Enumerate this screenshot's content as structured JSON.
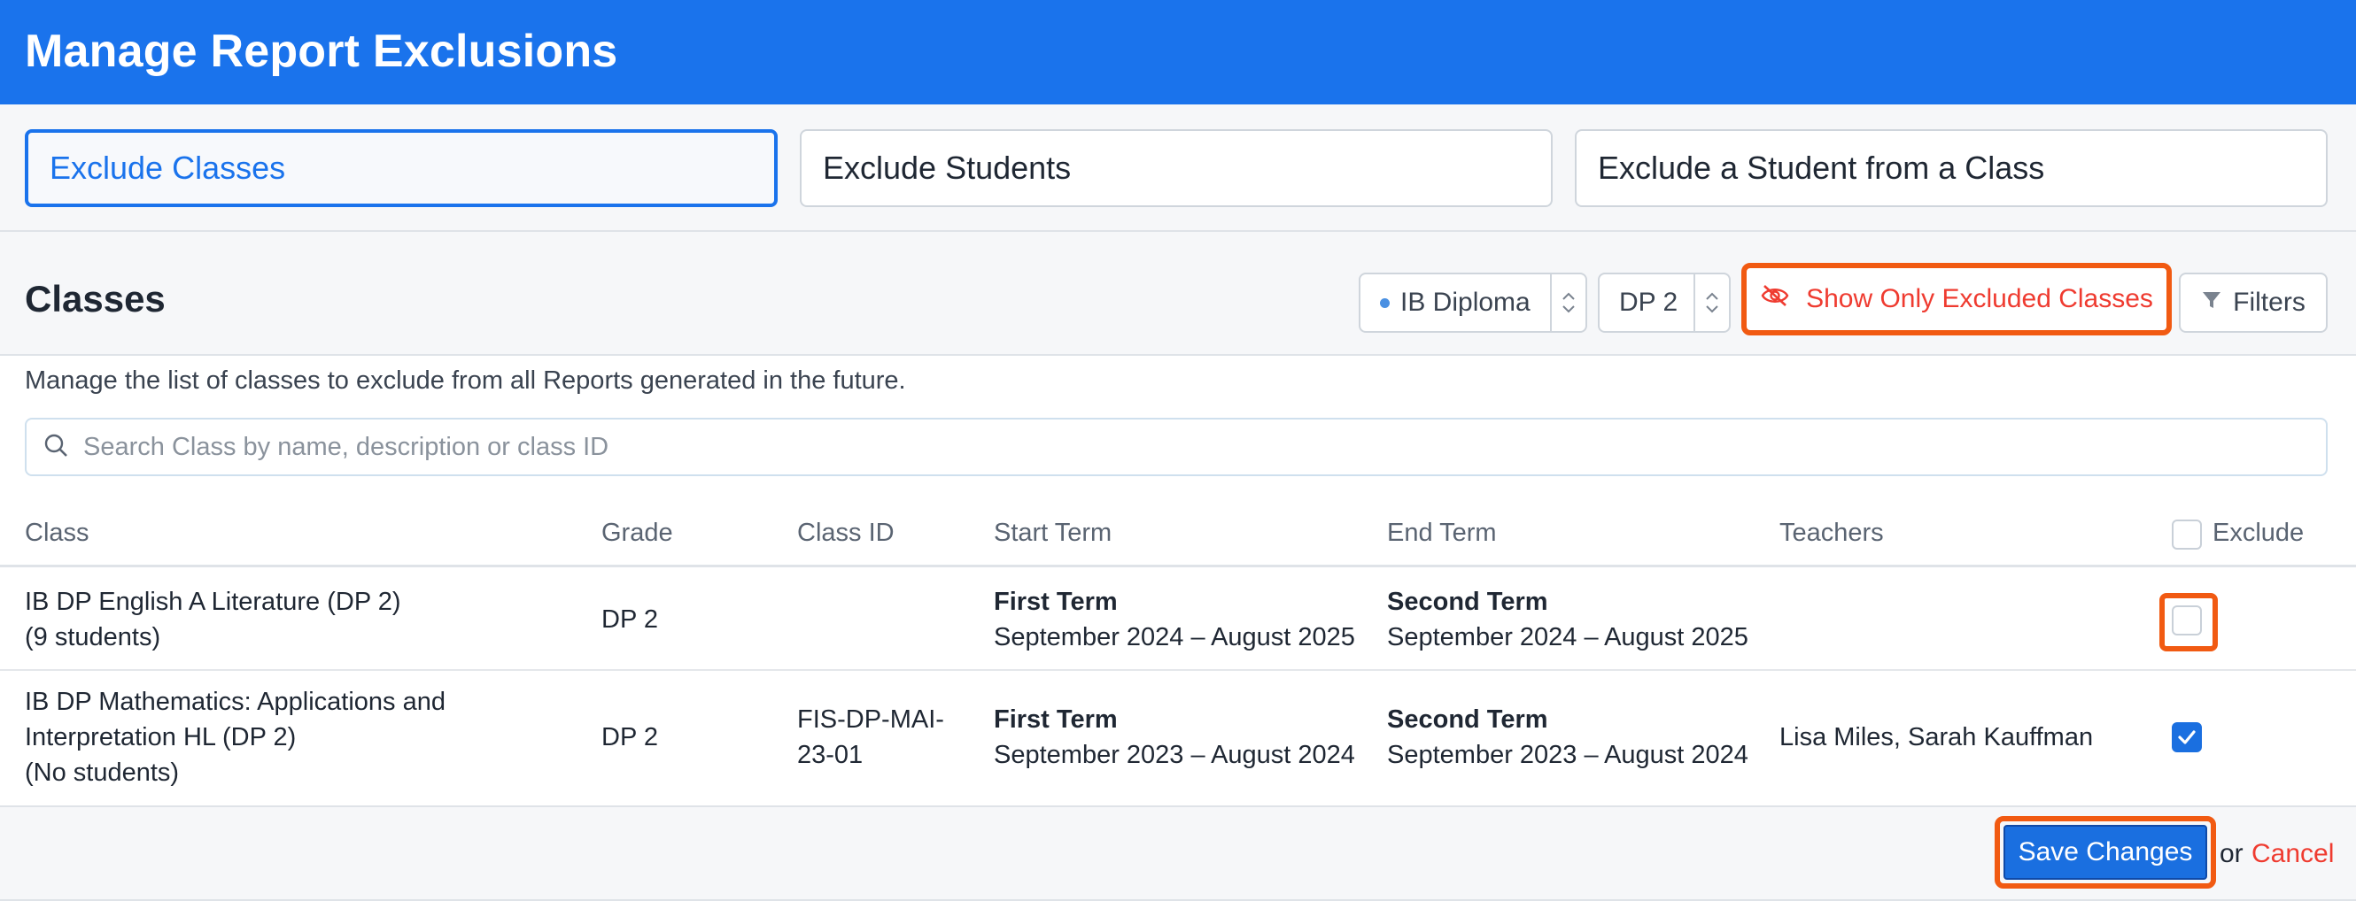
{
  "header": {
    "title": "Manage Report Exclusions"
  },
  "tabs": [
    {
      "label": "Exclude Classes",
      "active": true
    },
    {
      "label": "Exclude Students",
      "active": false
    },
    {
      "label": "Exclude a Student from a Class",
      "active": false
    }
  ],
  "toolbar": {
    "title": "Classes",
    "program_select": "IB Diploma",
    "grade_select": "DP 2",
    "show_excluded_label": "Show Only Excluded Classes",
    "filters_label": "Filters"
  },
  "description": "Manage the list of classes to exclude from all Reports generated in the future.",
  "search": {
    "placeholder": "Search Class by name, description or class ID",
    "value": ""
  },
  "table": {
    "headers": {
      "class": "Class",
      "grade": "Grade",
      "class_id": "Class ID",
      "start_term": "Start Term",
      "end_term": "End Term",
      "teachers": "Teachers",
      "exclude": "Exclude"
    },
    "rows": [
      {
        "class_line1": "IB DP English A Literature (DP 2)",
        "class_line2": "",
        "class_line3": "(9 students)",
        "grade": "DP 2",
        "class_id_line1": "",
        "class_id_line2": "",
        "start_term_name": "First Term",
        "start_term_dates": "September 2024 – August 2025",
        "end_term_name": "Second Term",
        "end_term_dates": "September 2024 – August 2025",
        "teachers": "",
        "excluded": false
      },
      {
        "class_line1": "IB DP Mathematics: Applications and",
        "class_line2": "Interpretation HL (DP 2)",
        "class_line3": "(No students)",
        "grade": "DP 2",
        "class_id_line1": "FIS-DP-MAI-",
        "class_id_line2": "23-01",
        "start_term_name": "First Term",
        "start_term_dates": "September 2023 – August 2024",
        "end_term_name": "Second Term",
        "end_term_dates": "September 2023 – August 2024",
        "teachers": "Lisa Miles, Sarah Kauffman",
        "excluded": true
      }
    ]
  },
  "footer": {
    "save_label": "Save Changes",
    "or_text": "or",
    "cancel_label": "Cancel"
  },
  "colors": {
    "primary": "#1a73ec",
    "danger": "#ef3b30",
    "highlight": "#f15a12"
  },
  "icons": {
    "excluded_button": "eye-slash-icon",
    "filters_button": "filter-icon",
    "search_field": "search-icon"
  }
}
